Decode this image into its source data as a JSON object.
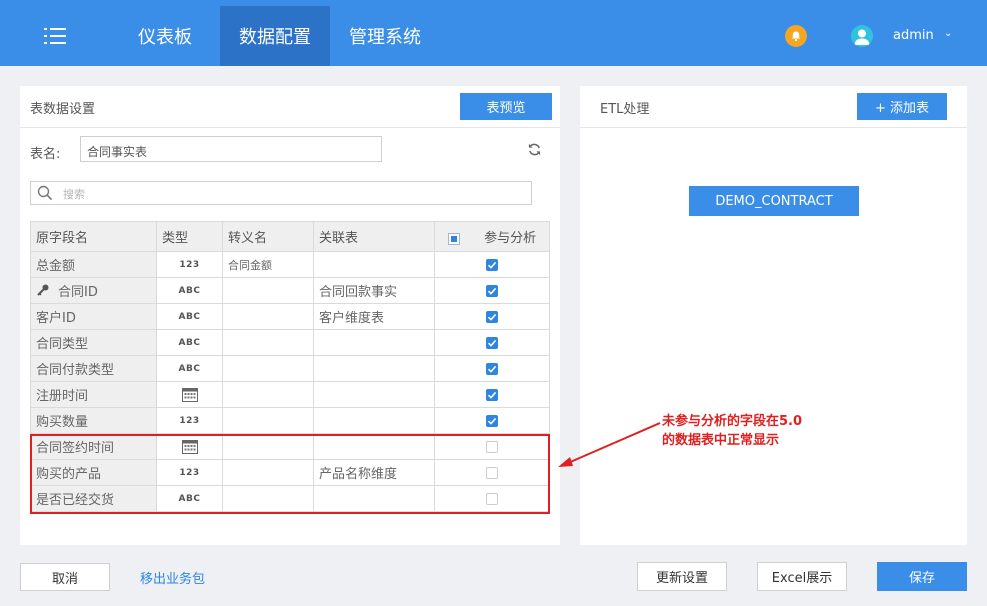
{
  "nav": {
    "dashboard": "仪表板",
    "data_config": "数据配置",
    "admin_system": "管理系统"
  },
  "user": {
    "name": "admin",
    "caret": "⌄"
  },
  "left_panel": {
    "title": "表数据设置",
    "preview_button": "表预览",
    "table_name_label": "表名:",
    "table_name_value": "合同事实表",
    "search_placeholder": "搜索",
    "columns": [
      "原字段名",
      "类型",
      "转义名",
      "关联表",
      "参与分析"
    ],
    "rows": [
      {
        "field": "总金额",
        "type": "123",
        "alias": "合同金额",
        "relation": "",
        "checked": true
      },
      {
        "field": "合同ID",
        "type": "ABC",
        "alias": "",
        "relation": "合同回款事实",
        "checked": true,
        "key": true
      },
      {
        "field": "客户ID",
        "type": "ABC",
        "alias": "",
        "relation": "客户维度表",
        "checked": true
      },
      {
        "field": "合同类型",
        "type": "ABC",
        "alias": "",
        "relation": "",
        "checked": true
      },
      {
        "field": "合同付款类型",
        "type": "ABC",
        "alias": "",
        "relation": "",
        "checked": true
      },
      {
        "field": "注册时间",
        "type": "date",
        "alias": "",
        "relation": "",
        "checked": true
      },
      {
        "field": "购买数量",
        "type": "123",
        "alias": "",
        "relation": "",
        "checked": true
      },
      {
        "field": "合同签约时间",
        "type": "date",
        "alias": "",
        "relation": "",
        "checked": false
      },
      {
        "field": "购买的产品",
        "type": "123",
        "alias": "",
        "relation": "产品名称维度",
        "checked": false
      },
      {
        "field": "是否已经交货",
        "type": "ABC",
        "alias": "",
        "relation": "",
        "checked": false
      }
    ]
  },
  "right_panel": {
    "title": "ETL处理",
    "add_button": "+ 添加表",
    "demo_table": "DEMO_CONTRACT"
  },
  "annotation": {
    "line1": "未参与分析的字段在5.0",
    "line2": "的数据表中正常显示"
  },
  "footer": {
    "cancel": "取消",
    "move_out": "移出业务包",
    "update": "更新设置",
    "excel": "Excel展示",
    "save": "保存"
  },
  "colors": {
    "primary": "#3b8ee8",
    "nav_active": "#2c73c7",
    "highlight": "#e02020",
    "checkbox": "#2e86de"
  }
}
